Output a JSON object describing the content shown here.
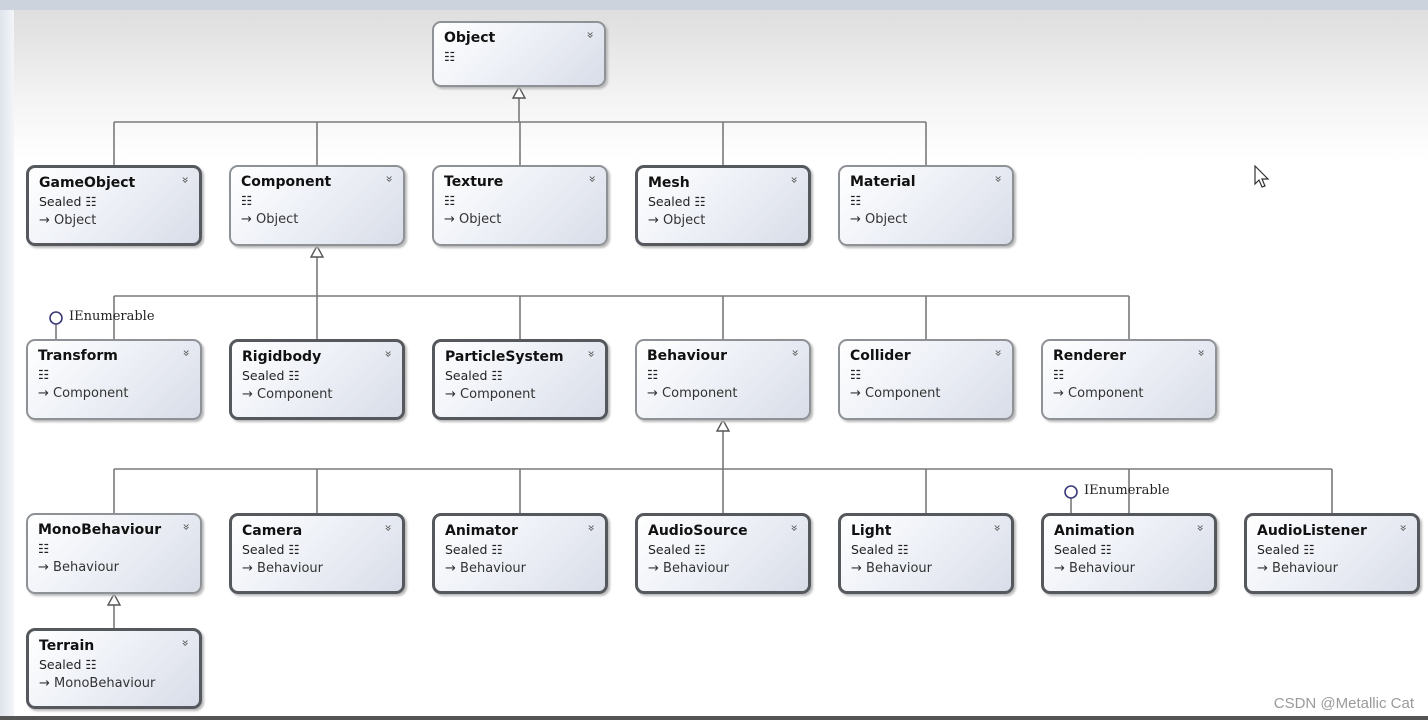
{
  "nodes": [
    {
      "id": "Object",
      "name": "Object",
      "sealed": false,
      "base": "",
      "kind": ""
    },
    {
      "id": "GameObject",
      "name": "GameObject",
      "sealed": true,
      "kind": "Sealed",
      "base": "Object"
    },
    {
      "id": "Component",
      "name": "Component",
      "sealed": false,
      "kind": "",
      "base": "Object"
    },
    {
      "id": "Texture",
      "name": "Texture",
      "sealed": false,
      "kind": "",
      "base": "Object"
    },
    {
      "id": "Mesh",
      "name": "Mesh",
      "sealed": true,
      "kind": "Sealed",
      "base": "Object"
    },
    {
      "id": "Material",
      "name": "Material",
      "sealed": false,
      "kind": "",
      "base": "Object"
    },
    {
      "id": "Transform",
      "name": "Transform",
      "sealed": false,
      "kind": "",
      "base": "Component"
    },
    {
      "id": "Rigidbody",
      "name": "Rigidbody",
      "sealed": true,
      "kind": "Sealed",
      "base": "Component"
    },
    {
      "id": "ParticleSystem",
      "name": "ParticleSystem",
      "sealed": true,
      "kind": "Sealed",
      "base": "Component"
    },
    {
      "id": "Behaviour",
      "name": "Behaviour",
      "sealed": false,
      "kind": "",
      "base": "Component"
    },
    {
      "id": "Collider",
      "name": "Collider",
      "sealed": false,
      "kind": "",
      "base": "Component"
    },
    {
      "id": "Renderer",
      "name": "Renderer",
      "sealed": false,
      "kind": "",
      "base": "Component"
    },
    {
      "id": "MonoBehaviour",
      "name": "MonoBehaviour",
      "sealed": false,
      "kind": "",
      "base": "Behaviour"
    },
    {
      "id": "Camera",
      "name": "Camera",
      "sealed": true,
      "kind": "Sealed",
      "base": "Behaviour"
    },
    {
      "id": "Animator",
      "name": "Animator",
      "sealed": true,
      "kind": "Sealed",
      "base": "Behaviour"
    },
    {
      "id": "AudioSource",
      "name": "AudioSource",
      "sealed": true,
      "kind": "Sealed",
      "base": "Behaviour"
    },
    {
      "id": "Light",
      "name": "Light",
      "sealed": true,
      "kind": "Sealed",
      "base": "Behaviour"
    },
    {
      "id": "Animation",
      "name": "Animation",
      "sealed": true,
      "kind": "Sealed",
      "base": "Behaviour"
    },
    {
      "id": "AudioListener",
      "name": "AudioListener",
      "sealed": true,
      "kind": "Sealed",
      "base": "Behaviour"
    },
    {
      "id": "Terrain",
      "name": "Terrain",
      "sealed": true,
      "kind": "Sealed",
      "base": "MonoBehaviour"
    }
  ],
  "interfaces": [
    {
      "on": "Transform",
      "label": "IEnumerable"
    },
    {
      "on": "Animation",
      "label": "IEnumerable"
    }
  ],
  "icons": {
    "class": "class-icon",
    "expand": "chevron-double-down-icon",
    "inherits": "inheritance-arrow-icon",
    "interface": "lollipop-interface-icon",
    "cursor": "mouse-cursor-icon"
  },
  "glyphs": {
    "class": "☷",
    "expand": "»",
    "inherits": "→"
  },
  "watermark": "CSDN @Metallic Cat"
}
